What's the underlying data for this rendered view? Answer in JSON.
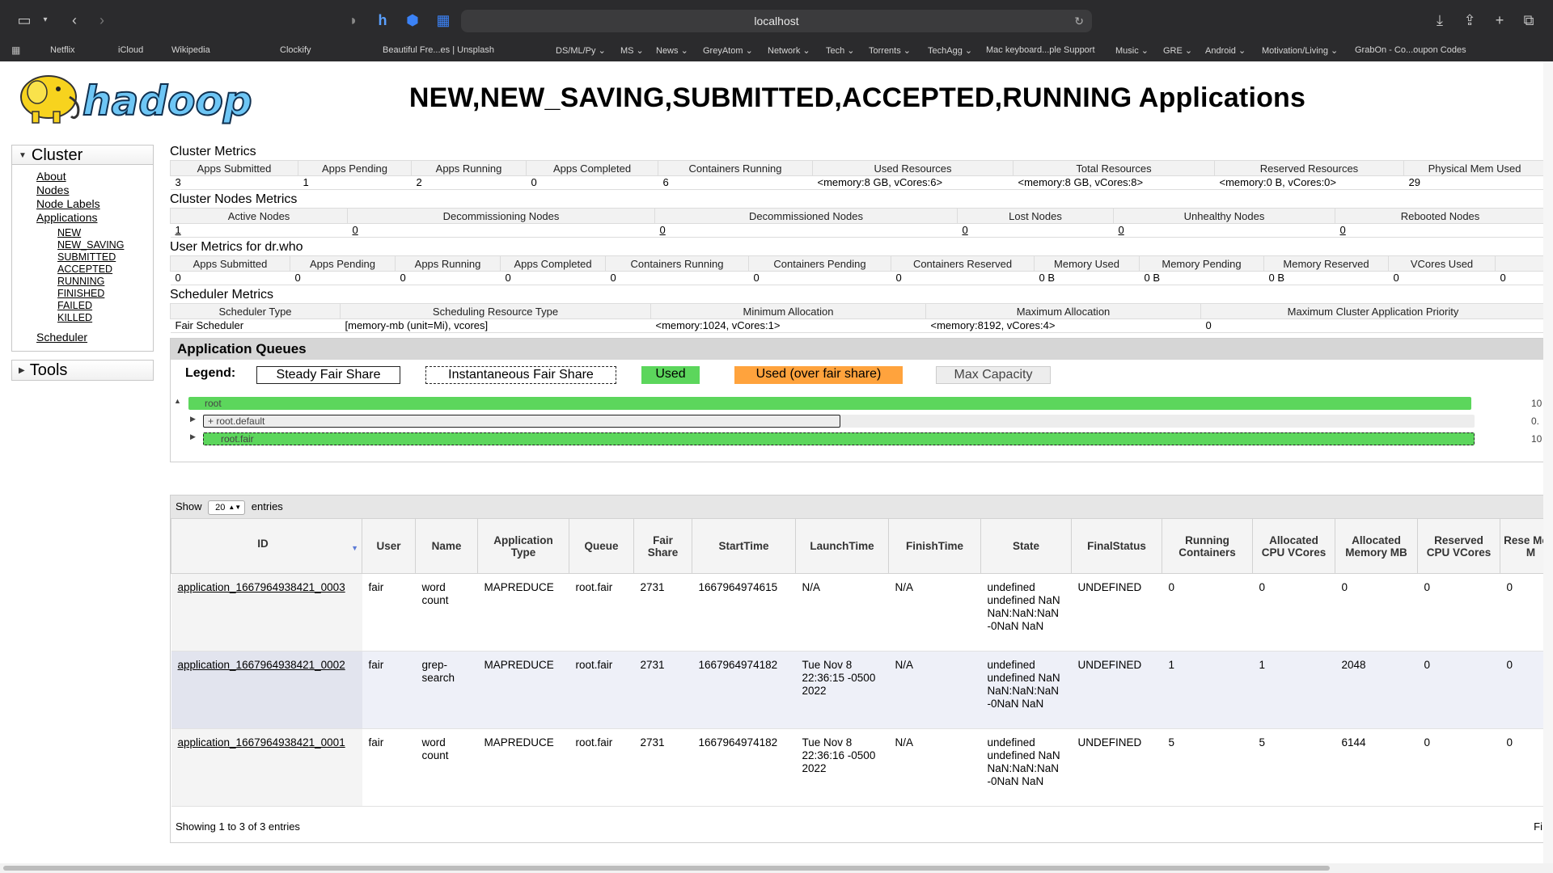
{
  "browser": {
    "url": "localhost",
    "bookmarks": [
      "Netflix",
      "iCloud",
      "Wikipedia",
      "Clockify",
      "Beautiful Fre...es | Unsplash",
      "DS/ML/Py",
      "MS",
      "News",
      "GreyAtom",
      "Network",
      "Tech",
      "Torrents",
      "TechAgg",
      "Mac keyboard...ple Support",
      "Music",
      "GRE",
      "Android",
      "Motivation/Living",
      "GrabOn - Co...oupon Codes"
    ]
  },
  "page": {
    "title": "NEW,NEW_SAVING,SUBMITTED,ACCEPTED,RUNNING Applications",
    "logo_text": "hadoop"
  },
  "nav": {
    "cluster": "Cluster",
    "links": [
      "About",
      "Nodes",
      "Node Labels",
      "Applications"
    ],
    "app_states": [
      "NEW",
      "NEW_SAVING",
      "SUBMITTED",
      "ACCEPTED",
      "RUNNING",
      "FINISHED",
      "FAILED",
      "KILLED"
    ],
    "scheduler": "Scheduler",
    "tools": "Tools"
  },
  "cluster_metrics": {
    "title": "Cluster Metrics",
    "headers": [
      "Apps Submitted",
      "Apps Pending",
      "Apps Running",
      "Apps Completed",
      "Containers Running",
      "Used Resources",
      "Total Resources",
      "Reserved Resources",
      "Physical Mem Used"
    ],
    "values": [
      "3",
      "1",
      "2",
      "0",
      "6",
      "<memory:8 GB, vCores:6>",
      "<memory:8 GB, vCores:8>",
      "<memory:0 B, vCores:0>",
      "29"
    ]
  },
  "node_metrics": {
    "title": "Cluster Nodes Metrics",
    "headers": [
      "Active Nodes",
      "Decommissioning Nodes",
      "Decommissioned Nodes",
      "Lost Nodes",
      "Unhealthy Nodes",
      "Rebooted Nodes"
    ],
    "values": [
      "1",
      "0",
      "0",
      "0",
      "0",
      "0"
    ]
  },
  "user_metrics": {
    "title": "User Metrics for dr.who",
    "headers": [
      "Apps Submitted",
      "Apps Pending",
      "Apps Running",
      "Apps Completed",
      "Containers Running",
      "Containers Pending",
      "Containers Reserved",
      "Memory Used",
      "Memory Pending",
      "Memory Reserved",
      "VCores Used"
    ],
    "values": [
      "0",
      "0",
      "0",
      "0",
      "0",
      "0",
      "0",
      "0 B",
      "0 B",
      "0 B",
      "0",
      "0"
    ]
  },
  "scheduler_metrics": {
    "title": "Scheduler Metrics",
    "headers": [
      "Scheduler Type",
      "Scheduling Resource Type",
      "Minimum Allocation",
      "Maximum Allocation",
      "Maximum Cluster Application Priority"
    ],
    "values": [
      "Fair Scheduler",
      "[memory-mb (unit=Mi), vcores]",
      "<memory:1024, vCores:1>",
      "<memory:8192, vCores:4>",
      "0"
    ]
  },
  "queues": {
    "title": "Application Queues",
    "legend_label": "Legend:",
    "legend": [
      "Steady Fair Share",
      "Instantaneous Fair Share",
      "Used",
      "Used (over fair share)",
      "Max Capacity"
    ],
    "rows": [
      {
        "name": "root",
        "value": "10"
      },
      {
        "name": "+ root.default",
        "value": "0."
      },
      {
        "name": "root.fair",
        "value": "10"
      }
    ]
  },
  "apps_table": {
    "show_label": "Show",
    "page_size": "20",
    "entries_label": "entries",
    "headers": [
      "ID",
      "User",
      "Name",
      "Application Type",
      "Queue",
      "Fair Share",
      "StartTime",
      "LaunchTime",
      "FinishTime",
      "State",
      "FinalStatus",
      "Running Containers",
      "Allocated CPU VCores",
      "Allocated Memory MB",
      "Reserved CPU VCores",
      "Rese Mem M"
    ],
    "rows": [
      {
        "id": "application_1667964938421_0003",
        "user": "fair",
        "name": "word count",
        "type": "MAPREDUCE",
        "queue": "root.fair",
        "fair_share": "2731",
        "start": "1667964974615",
        "launch": "N/A",
        "finish": "N/A",
        "state": "undefined undefined NaN NaN:NaN:NaN -0NaN NaN",
        "final": "UNDEFINED",
        "running": "0",
        "cpu": "0",
        "mem": "0",
        "rcpu": "0",
        "rmem": "0"
      },
      {
        "id": "application_1667964938421_0002",
        "user": "fair",
        "name": "grep-search",
        "type": "MAPREDUCE",
        "queue": "root.fair",
        "fair_share": "2731",
        "start": "1667964974182",
        "launch": "Tue Nov 8 22:36:15 -0500 2022",
        "finish": "N/A",
        "state": "undefined undefined NaN NaN:NaN:NaN -0NaN NaN",
        "final": "UNDEFINED",
        "running": "1",
        "cpu": "1",
        "mem": "2048",
        "rcpu": "0",
        "rmem": "0"
      },
      {
        "id": "application_1667964938421_0001",
        "user": "fair",
        "name": "word count",
        "type": "MAPREDUCE",
        "queue": "root.fair",
        "fair_share": "2731",
        "start": "1667964974182",
        "launch": "Tue Nov 8 22:36:16 -0500 2022",
        "finish": "N/A",
        "state": "undefined undefined NaN NaN:NaN:NaN -0NaN NaN",
        "final": "UNDEFINED",
        "running": "5",
        "cpu": "5",
        "mem": "6144",
        "rcpu": "0",
        "rmem": "0"
      }
    ],
    "footer": "Showing 1 to 3 of 3 entries",
    "footer_right": "Fi"
  },
  "colors": {
    "used": "#5cd65c",
    "over": "#ffa33d",
    "chrome": "#2b2b2d"
  }
}
